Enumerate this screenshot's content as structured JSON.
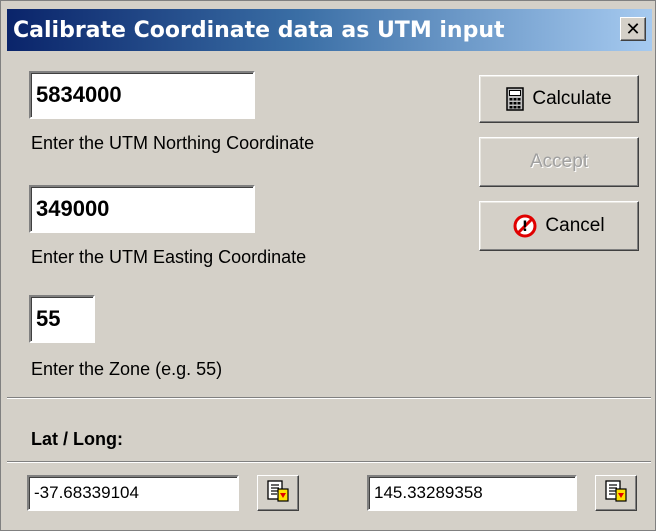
{
  "window": {
    "title": "Calibrate Coordinate data as UTM input",
    "close_label": "✕"
  },
  "fields": {
    "northing": {
      "value": "5834000",
      "label": "Enter the UTM Northing Coordinate"
    },
    "easting": {
      "value": "349000",
      "label": "Enter the UTM Easting Coordinate"
    },
    "zone": {
      "value": "55",
      "label": "Enter the Zone (e.g. 55)"
    }
  },
  "buttons": {
    "calculate": "Calculate",
    "accept": "Accept",
    "cancel": "Cancel"
  },
  "latlong": {
    "heading": "Lat / Long:",
    "latitude": "-37.68339104",
    "longitude": "145.33289358"
  },
  "icons": {
    "calculate": "calculator-icon",
    "cancel": "stop-icon",
    "copy": "copy-to-clipboard-icon"
  },
  "colors": {
    "titlebar_start": "#0a246a",
    "titlebar_end": "#a6caf0",
    "face": "#d4d0c8",
    "cancel_icon": "#e00000"
  }
}
